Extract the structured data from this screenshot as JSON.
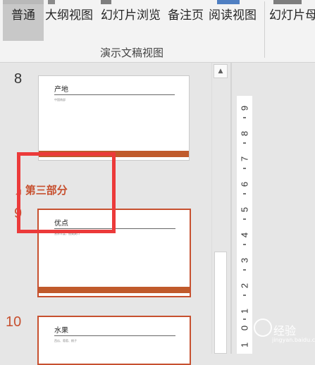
{
  "ribbon": {
    "buttons": {
      "normal": "普通",
      "outline": "大纲视图",
      "slide_sorter": "幻灯片浏览",
      "notes_page": "备注页",
      "reading_view": "阅读视图",
      "slide_master": "幻灯片母"
    },
    "group_label": "演示文稿视图",
    "active_button": "normal"
  },
  "thumbnails": {
    "section_name": "第三部分",
    "slides": [
      {
        "number": "8",
        "title": "产地",
        "subtitle": "中国南部",
        "selected": false
      },
      {
        "number": "9",
        "title": "优点",
        "subtitle": "营养丰富，甜美爽口",
        "selected": true
      },
      {
        "number": "10",
        "title": "水果",
        "subtitle": "西瓜、葡萄、桃子",
        "selected": true
      }
    ]
  },
  "ruler": {
    "labels": [
      "9",
      "8",
      "7",
      "6",
      "5",
      "4",
      "3",
      "2",
      "1",
      "0",
      "1"
    ]
  },
  "watermark": {
    "text": "经验",
    "url": "jingyan.baidu.com"
  },
  "colors": {
    "accent": "#c7502f",
    "highlight": "#ec3a3a",
    "slide_bar": "#c05a2b"
  }
}
